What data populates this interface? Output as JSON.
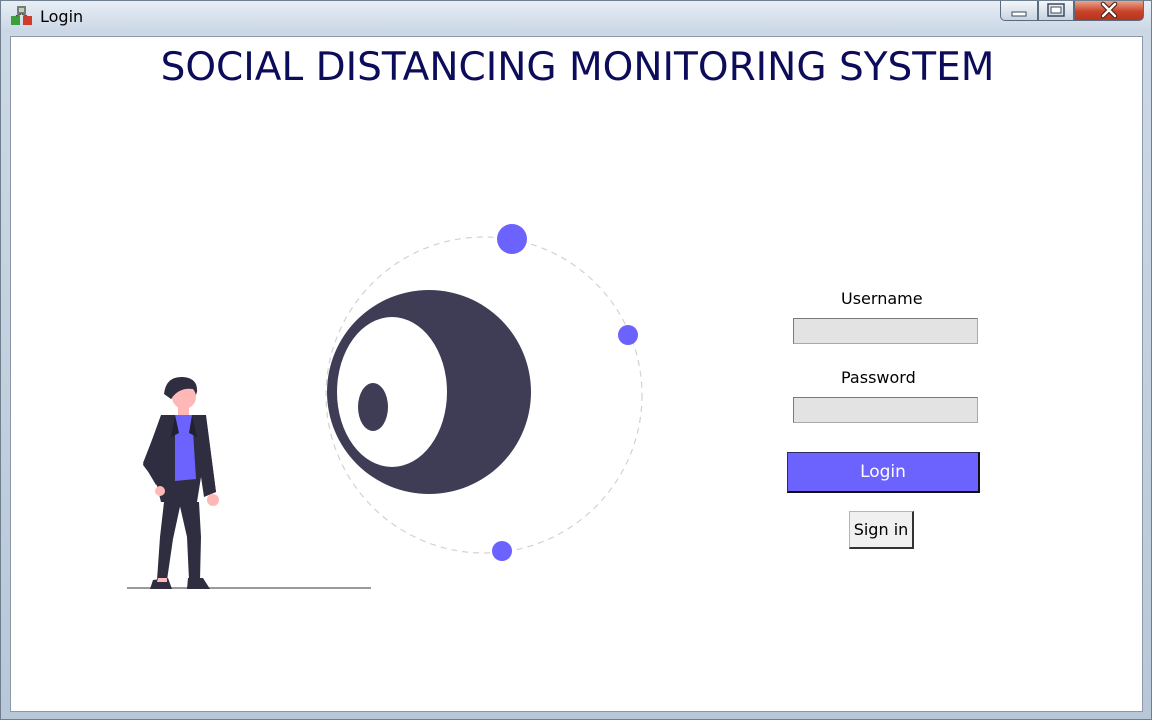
{
  "window": {
    "title": "Login",
    "controls": {
      "minimize_icon": "minimize-icon",
      "maximize_icon": "maximize-icon",
      "close_icon": "close-icon"
    }
  },
  "main": {
    "heading": "SOCIAL DISTANCING MONITORING SYSTEM",
    "illustration": "person-looking-at-eye-orbit"
  },
  "form": {
    "username_label": "Username",
    "username_value": "",
    "password_label": "Password",
    "password_value": "",
    "login_label": "Login",
    "signin_label": "Sign in"
  },
  "colors": {
    "accent": "#6c63ff",
    "heading": "#0d0c5a",
    "illustration_dark": "#3f3d56",
    "field_bg": "#e3e3e3"
  }
}
